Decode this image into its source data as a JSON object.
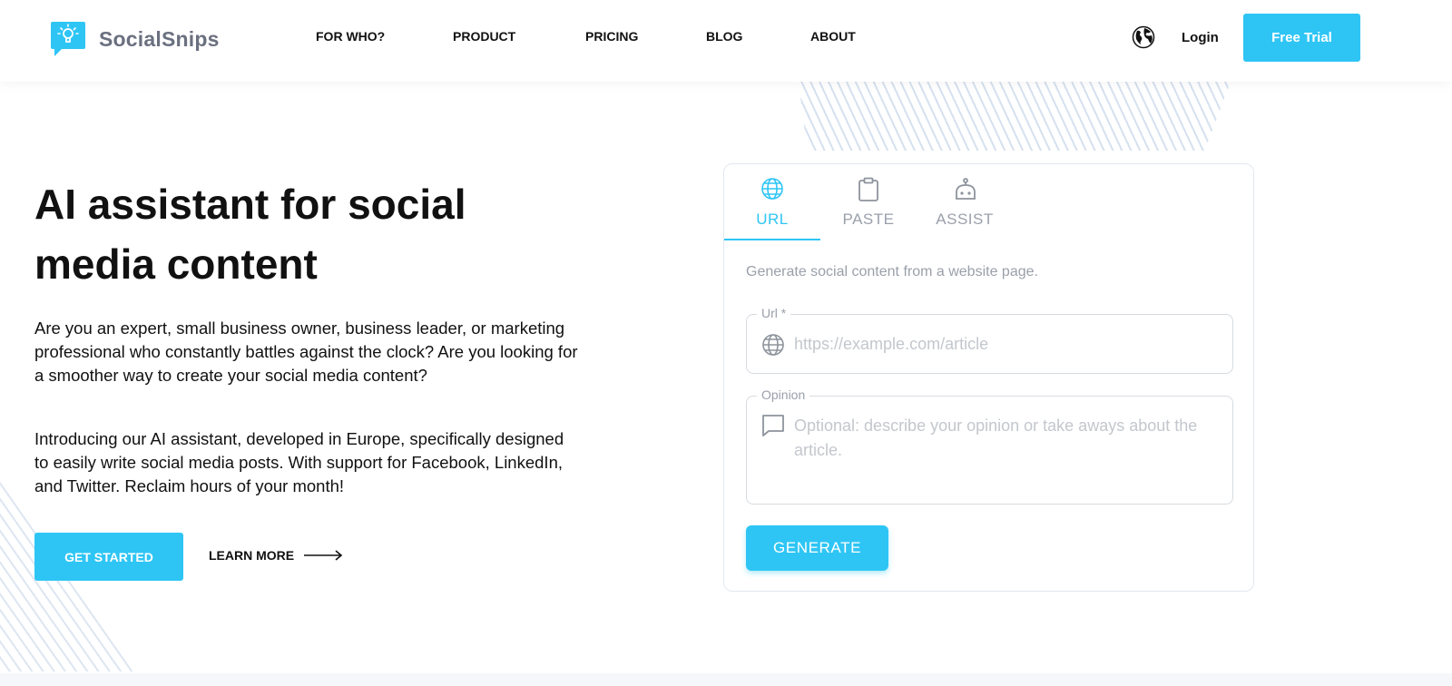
{
  "brand": {
    "name": "SocialSnips",
    "accent_color": "#2ec5f5",
    "logo_icon": "lightbulb-chat-icon"
  },
  "nav": {
    "items": [
      {
        "label": "FOR WHO?"
      },
      {
        "label": "PRODUCT"
      },
      {
        "label": "PRICING"
      },
      {
        "label": "BLOG"
      },
      {
        "label": "ABOUT"
      }
    ],
    "language_icon": "globe-icon",
    "login_label": "Login",
    "trial_label": "Free Trial"
  },
  "hero": {
    "title": "AI assistant for social media content",
    "paragraph_1": "Are you an expert, small business owner, business leader, or marketing professional who constantly battles against the clock? Are you looking for a smoother way to create your social media content?",
    "paragraph_2": "Introducing our AI assistant, developed in Europe, specifically designed to easily write social media posts. With support for Facebook, LinkedIn, and Twitter. Reclaim hours of your month!",
    "get_started_label": "GET STARTED",
    "learn_more_label": "LEARN MORE"
  },
  "generator": {
    "tabs": [
      {
        "label": "URL",
        "icon": "globe-icon",
        "active": true
      },
      {
        "label": "PASTE",
        "icon": "clipboard-icon",
        "active": false
      },
      {
        "label": "ASSIST",
        "icon": "robot-icon",
        "active": false
      }
    ],
    "description": "Generate social content from a website page.",
    "url_field": {
      "label": "Url *",
      "placeholder": "https://example.com/article",
      "value": ""
    },
    "opinion_field": {
      "label": "Opinion",
      "placeholder": "Optional: describe your opinion or take aways about the article.",
      "value": ""
    },
    "generate_label": "GENERATE"
  }
}
